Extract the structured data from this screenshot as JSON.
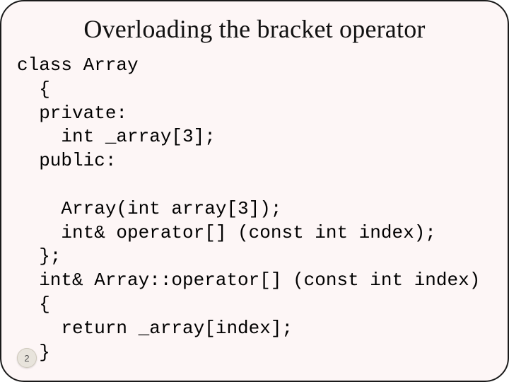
{
  "title": "Overloading the bracket operator",
  "code": {
    "l1": "class Array",
    "l2": "  {",
    "l3": "  private:",
    "l4": "    int _array[3];",
    "l5": "  public:",
    "l6": "",
    "l7": "    Array(int array[3]);",
    "l8": "    int& operator[] (const int index);",
    "l9": "  };",
    "l10": "  int& Array::operator[] (const int index)",
    "l11": "  {",
    "l12": "    return _array[index];",
    "l13": "  }"
  },
  "slide_number": "2"
}
